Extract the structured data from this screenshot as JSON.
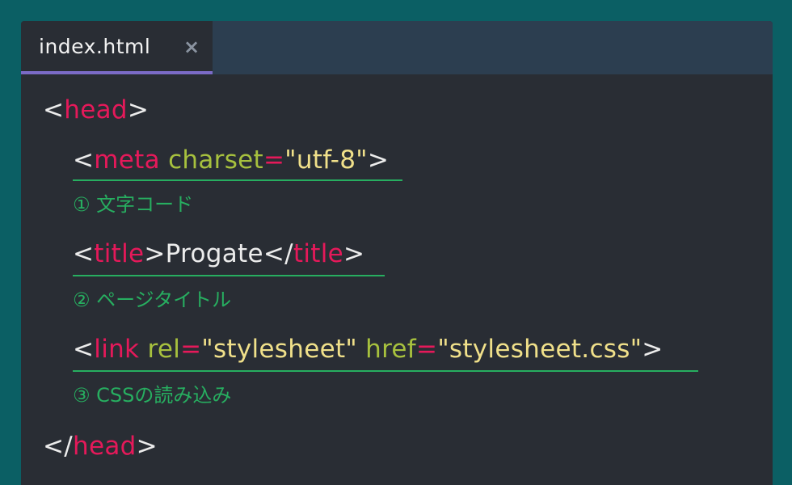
{
  "tab": {
    "label": "index.html",
    "close_symbol": "×"
  },
  "code": {
    "head_open": {
      "lt": "<",
      "tag": "head",
      "gt": ">"
    },
    "meta": {
      "lt": "<",
      "tag": "meta",
      "attr": "charset",
      "eq": "=",
      "value": "\"utf-8\"",
      "gt": ">",
      "note": "① 文字コード"
    },
    "title": {
      "lt": "<",
      "tag": "title",
      "gt": ">",
      "text": "Progate",
      "close_lt": "</",
      "close_tag": "title",
      "close_gt": ">",
      "note": "② ページタイトル"
    },
    "link": {
      "lt": "<",
      "tag": "link",
      "attr1": "rel",
      "eq1": "=",
      "value1": "\"stylesheet\"",
      "attr2": "href",
      "eq2": "=",
      "value2": "\"stylesheet.css\"",
      "gt": ">",
      "note": "③ CSSの読み込み"
    },
    "head_close": {
      "lt": "</",
      "tag": "head",
      "gt": ">"
    }
  },
  "colors": {
    "background": "#0b5f64",
    "editor": "#292d34",
    "tabbar": "#2c3e50",
    "tab_accent": "#7b6bc7",
    "tag": "#e5195a",
    "attribute": "#a7c13e",
    "string": "#f0e08a",
    "annotation": "#27ae60"
  }
}
